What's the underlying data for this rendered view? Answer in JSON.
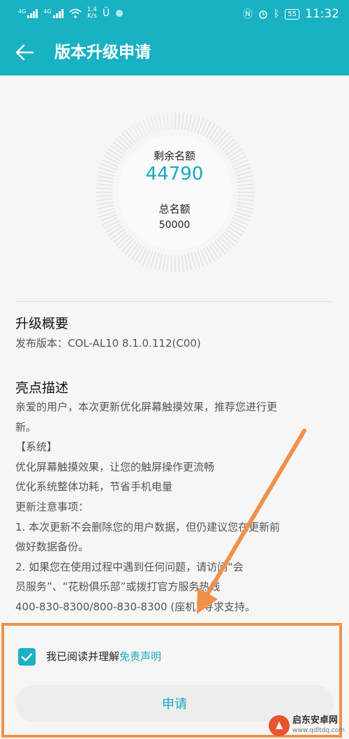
{
  "status_bar": {
    "network_tag_1": "4G",
    "network_tag_2": "4G",
    "speed_value": "1.4",
    "speed_unit": "K/s",
    "battery": "55",
    "time": "11:32"
  },
  "app_bar": {
    "title": "版本升级申请"
  },
  "quota": {
    "remaining_label": "剩余名额",
    "remaining_value": "44790",
    "total_label": "总名额",
    "total_value": "50000",
    "remaining_fraction": 0.8958
  },
  "summary": {
    "heading": "升级概要",
    "release_version": "发布版本：COL-AL10 8.1.0.112(C00)"
  },
  "highlights": {
    "heading": "亮点描述",
    "lines": [
      "亲爱的用户，本次更新优化屏幕触摸效果，推荐您进行更",
      "新。",
      "【系统】",
      "优化屏幕触摸效果，让您的触屏操作更流畅",
      "优化系统整体功耗，节省手机电量",
      "更新注意事项：",
      "1. 本次更新不会删除您的用户数据，但仍建议您在更新前",
      "做好数据备份。",
      "2. 如果您在使用过程中遇到任何问题，请访问“会",
      "员服务”、“花粉俱乐部”或拨打官方服务热线",
      "400-830-8300/800-830-8300 (座机) 寻求支持。"
    ]
  },
  "agreement": {
    "checked": true,
    "text": "我已阅读并理解",
    "link": "免责声明"
  },
  "apply_button": {
    "label": "申请"
  },
  "watermark": {
    "name": "启东安卓网",
    "url": "www.qdltdq.com"
  },
  "colors": {
    "accent": "#19b1c4",
    "annotation": "#f0914a"
  }
}
